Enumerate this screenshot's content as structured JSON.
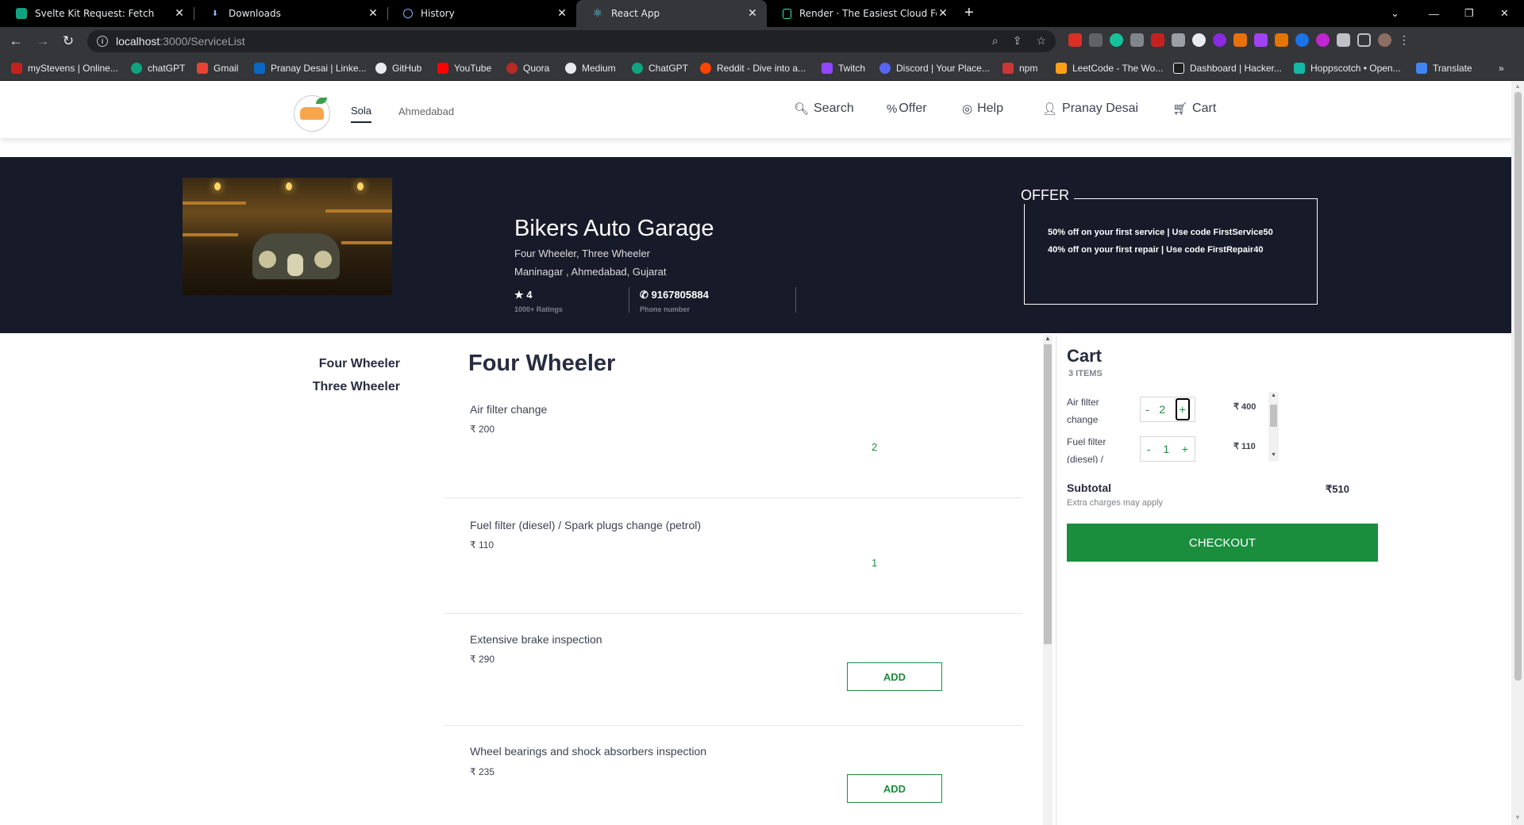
{
  "browser": {
    "tabs": [
      {
        "title": "Svelte Kit Request: Fetch",
        "icon": "openai-icon",
        "color": "#10a37f"
      },
      {
        "title": "Downloads",
        "icon": "download-icon",
        "color": "#8ab4f8"
      },
      {
        "title": "History",
        "icon": "history-icon",
        "color": "#8ab4f8"
      },
      {
        "title": "React App",
        "icon": "react-icon",
        "color": "#61dafb"
      },
      {
        "title": "Render · The Easiest Cloud For All",
        "icon": "render-icon",
        "color": "#46e3b7"
      }
    ],
    "url_host": "localhost",
    "url_path": ":3000/ServiceList",
    "bookmarks": [
      "myStevens | Online...",
      "chatGPT",
      "Gmail",
      "Pranay Desai | Linke...",
      "GitHub",
      "YouTube",
      "Quora",
      "Medium",
      "ChatGPT",
      "Reddit - Dive into a...",
      "Twitch",
      "Discord | Your Place...",
      "npm",
      "LeetCode - The Wo...",
      "Dashboard | Hacker...",
      "Hoppscotch • Open...",
      "Translate"
    ]
  },
  "header": {
    "location_main": "Sola",
    "location_sub": "Ahmedabad",
    "nav": {
      "search": "Search",
      "offer": "Offer",
      "help": "Help",
      "user": "Pranay Desai",
      "cart": "Cart"
    }
  },
  "shop": {
    "name": "Bikers Auto Garage",
    "categories": "Four Wheeler, Three Wheeler",
    "address": "Maninagar , Ahmedabad, Gujarat",
    "rating": "4",
    "rating_label": "1000+ Ratings",
    "phone": "9167805884",
    "phone_label": "Phone number"
  },
  "offer": {
    "title": "OFFER",
    "lines": [
      "50% off on your first service | Use code FirstService50",
      "40% off on your first repair | Use code FirstRepair40"
    ]
  },
  "sidebar": {
    "categories": [
      "Four Wheeler",
      "Three Wheeler"
    ]
  },
  "services": {
    "title": "Four Wheeler",
    "items": [
      {
        "name": "Air filter change",
        "price": "₹ 200",
        "qty": "2",
        "action": ""
      },
      {
        "name": "Fuel filter (diesel) / Spark plugs change (petrol)",
        "price": "₹ 110",
        "qty": "1",
        "action": ""
      },
      {
        "name": "Extensive brake inspection",
        "price": "₹ 290",
        "qty": "",
        "action": "ADD"
      },
      {
        "name": "Wheel bearings and shock absorbers inspection",
        "price": "₹ 235",
        "qty": "",
        "action": "ADD"
      }
    ]
  },
  "cart": {
    "title": "Cart",
    "count": "3 ITEMS",
    "items": [
      {
        "name": "Air filter change",
        "qty": "2",
        "price": "₹ 400"
      },
      {
        "name": "Fuel filter (diesel) /",
        "qty": "1",
        "price": "₹ 110"
      }
    ],
    "minus": "-",
    "plus": "+",
    "subtotal_label": "Subtotal",
    "subtotal_value": "₹510",
    "extra_note": "Extra charges may apply",
    "checkout": "CHECKOUT"
  },
  "colors": {
    "accent_green": "#1a8e3d",
    "banner_bg": "#171a29"
  }
}
